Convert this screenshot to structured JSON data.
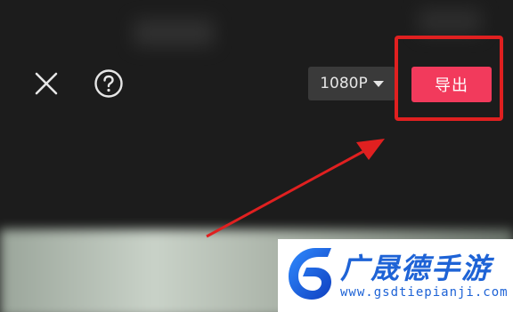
{
  "toolbar": {
    "close_icon": "close-icon",
    "help_icon": "help-icon",
    "resolution_value": "1080P",
    "export_label": "导出"
  },
  "watermark": {
    "brand": "广晟德手游",
    "url": "www.gsdtiepianji.com"
  },
  "colors": {
    "background": "#1c1c1c",
    "export_button": "#f23a5c",
    "annotation": "#e02020",
    "watermark_text": "#1e63d6"
  }
}
